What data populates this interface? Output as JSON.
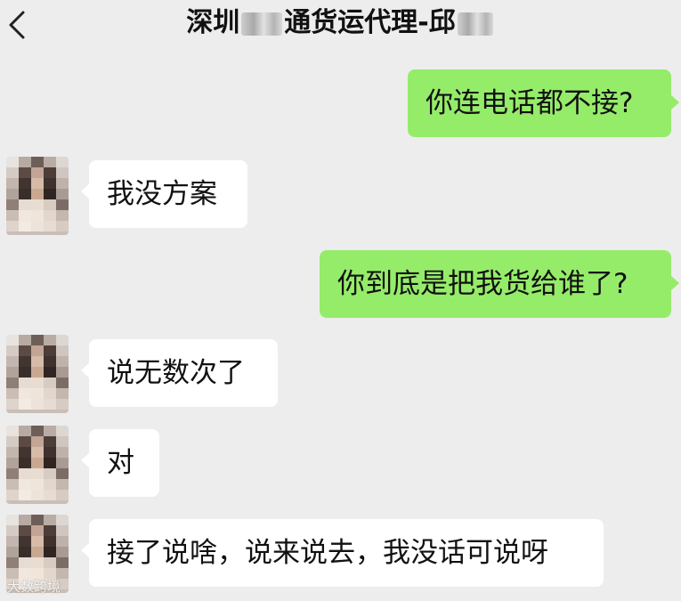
{
  "header": {
    "title_prefix": "深圳",
    "title_middle": "通货运代理-邱",
    "back_icon": "chevron-left-icon"
  },
  "messages": [
    {
      "side": "out",
      "text": "你连电话都不接?"
    },
    {
      "side": "in",
      "text": "我没方案"
    },
    {
      "side": "out",
      "text": "你到底是把我货给谁了?"
    },
    {
      "side": "in",
      "text": "说无数次了"
    },
    {
      "side": "in",
      "text": "对"
    },
    {
      "side": "in",
      "text": "接了说啥，说来说去，我没话可说呀"
    }
  ],
  "watermark": "大数跨境",
  "colors": {
    "background": "#ededed",
    "outgoing_bubble": "#95ec69",
    "incoming_bubble": "#ffffff"
  }
}
